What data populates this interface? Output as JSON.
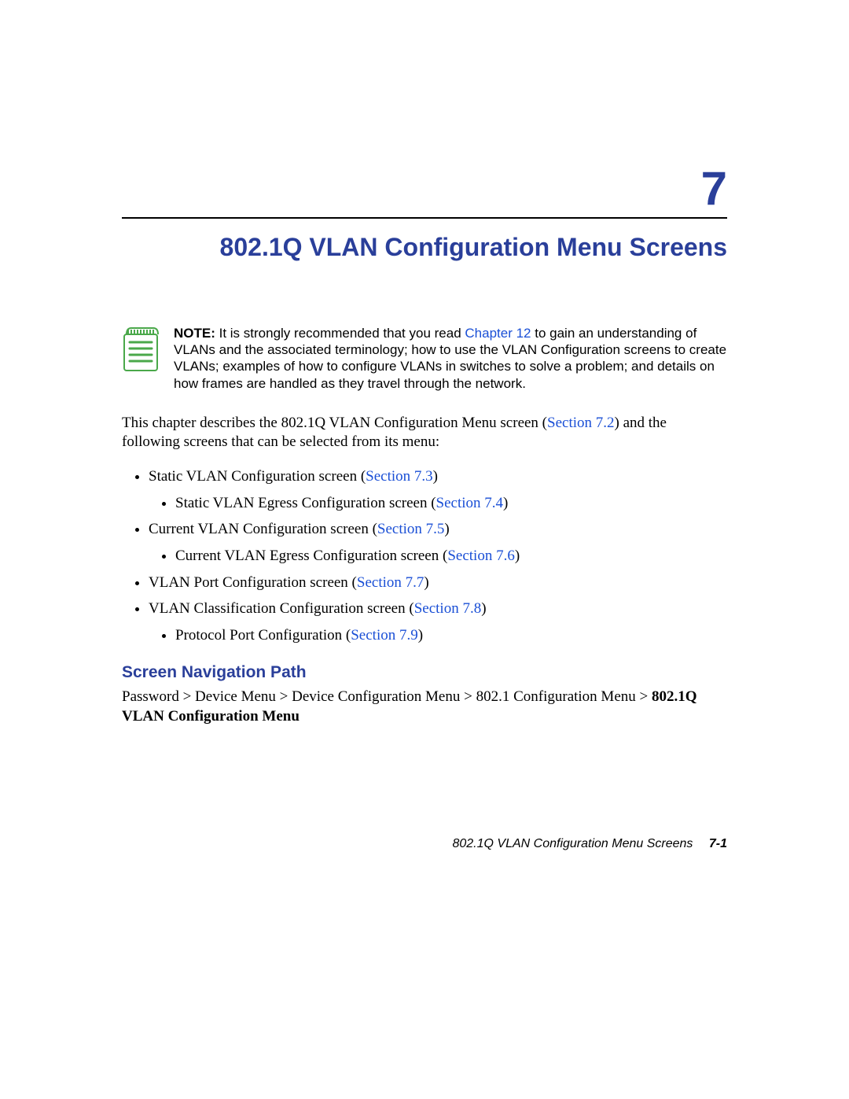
{
  "chapter": {
    "number": "7",
    "title": "802.1Q VLAN Configuration Menu Screens"
  },
  "note": {
    "label": "NOTE:",
    "pre": " It is strongly recommended that you read ",
    "link": "Chapter 12",
    "post": " to gain an understanding of VLANs and the associated terminology; how to use the VLAN Configuration screens to create VLANs; examples of how to configure VLANs in switches to solve a problem; and details on how frames are handled as they travel through the network."
  },
  "intro": {
    "pre": "This chapter describes the 802.1Q VLAN Configuration Menu screen (",
    "link": "Section 7.2",
    "post": ") and the following screens that can be selected from its menu:"
  },
  "list": {
    "i1_text": "Static VLAN Configuration screen (",
    "i1_link": "Section 7.3",
    "i1_close": ")",
    "i1a_text": "Static VLAN Egress Configuration screen (",
    "i1a_link": "Section 7.4",
    "i1a_close": ")",
    "i2_text": "Current VLAN Configuration screen (",
    "i2_link": "Section 7.5",
    "i2_close": ")",
    "i2a_text": "Current VLAN Egress Configuration screen (",
    "i2a_link": "Section 7.6",
    "i2a_close": ")",
    "i3_text": "VLAN Port Configuration screen (",
    "i3_link": "Section 7.7",
    "i3_close": ")",
    "i4_text": "VLAN Classification Configuration screen (",
    "i4_link": "Section 7.8",
    "i4_close": ")",
    "i4a_text": "Protocol Port Configuration (",
    "i4a_link": "Section 7.9",
    "i4a_close": ")"
  },
  "nav": {
    "heading": "Screen Navigation Path",
    "path_plain": "Password > Device Menu > Device Configuration Menu > 802.1 Configuration Menu > ",
    "path_bold": "802.1Q VLAN Configuration Menu"
  },
  "footer": {
    "title": "802.1Q VLAN Configuration Menu Screens",
    "page": "7-1"
  }
}
